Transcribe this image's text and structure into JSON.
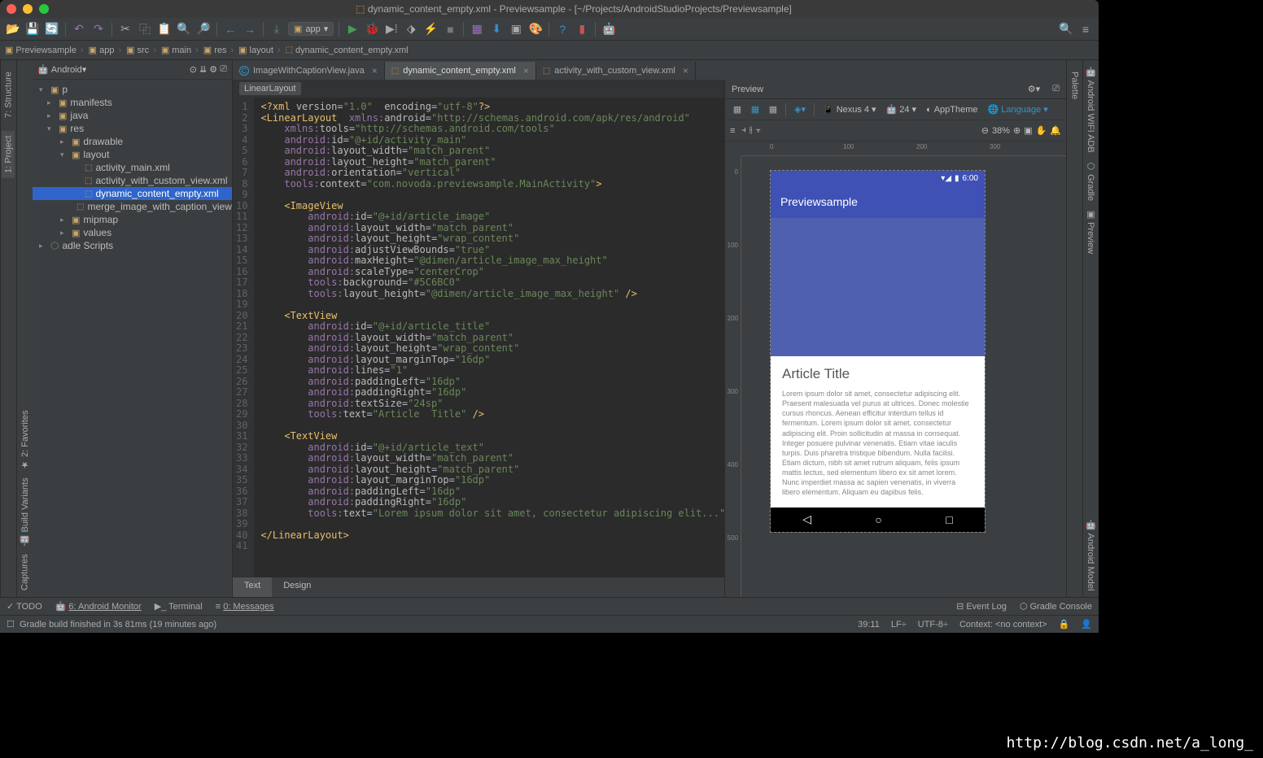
{
  "window_title": "dynamic_content_empty.xml - Previewsample - [~/Projects/AndroidStudioProjects/Previewsample]",
  "run_config": "app",
  "breadcrumb": [
    "Previewsample",
    "app",
    "src",
    "main",
    "res",
    "layout",
    "dynamic_content_empty.xml"
  ],
  "left_tabs": {
    "project": "1: Project",
    "structure": "7: Structure",
    "captures": "Captures",
    "bv": "Build Variants",
    "fav": "2: Favorites"
  },
  "project_header": "Android",
  "project_tree": {
    "root": "p",
    "items": [
      {
        "label": "manifests",
        "depth": 1,
        "icon": "folder",
        "tgl": "▸"
      },
      {
        "label": "java",
        "depth": 1,
        "icon": "folder",
        "tgl": "▸"
      },
      {
        "label": "res",
        "depth": 1,
        "icon": "folder",
        "tgl": "▾"
      },
      {
        "label": "drawable",
        "depth": 2,
        "icon": "folder",
        "tgl": "▸"
      },
      {
        "label": "layout",
        "depth": 2,
        "icon": "folder",
        "tgl": "▾"
      },
      {
        "label": "activity_main.xml",
        "depth": 3,
        "icon": "xml"
      },
      {
        "label": "activity_with_custom_view.xml",
        "depth": 3,
        "icon": "xml"
      },
      {
        "label": "dynamic_content_empty.xml",
        "depth": 3,
        "icon": "xml",
        "selected": true
      },
      {
        "label": "merge_image_with_caption_view.xml",
        "depth": 3,
        "icon": "xml"
      },
      {
        "label": "mipmap",
        "depth": 2,
        "icon": "folder",
        "tgl": "▸"
      },
      {
        "label": "values",
        "depth": 2,
        "icon": "folder",
        "tgl": "▸"
      }
    ],
    "scripts": "adle Scripts"
  },
  "editor_tabs": [
    {
      "label": "ImageWithCaptionView.java",
      "icon": "C"
    },
    {
      "label": "dynamic_content_empty.xml",
      "icon": "xml",
      "active": true
    },
    {
      "label": "activity_with_custom_view.xml",
      "icon": "xml"
    }
  ],
  "editor_crumb": "LinearLayout",
  "code_lines": 41,
  "bottom_tabs": {
    "text": "Text",
    "design": "Design"
  },
  "preview": {
    "title": "Preview",
    "device": "Nexus 4",
    "api": "24",
    "theme": "AppTheme",
    "lang": "Language",
    "zoom": "38%",
    "status_time": "6:00",
    "app_title": "Previewsample",
    "article_title": "Article Title",
    "article_text": "Lorem ipsum dolor sit amet, consectetur adipiscing elit. Praesent malesuada vel purus at ultrices. Donec molestie cursus rhoncus. Aenean efficitur interdum tellus id fermentum. Lorem ipsum dolor sit amet, consectetur adipiscing elit. Proin sollicitudin at massa in consequat. Integer posuere pulvinar venenatis. Etiam vitae iaculis turpis. Duis pharetra tristique bibendum. Nulla facilisi. Etiam dictum, nibh sit amet rutrum aliquam, felis ipsum mattis lectus, sed elementum libero ex sit amet lorem. Nunc imperdiet massa ac sapien venenatis, in viverra libero elementum. Aliquam eu dapibus felis."
  },
  "right_tabs": {
    "palette": "Palette",
    "adb": "Android WIFI ADB",
    "gradle": "Gradle",
    "preview": "Preview",
    "model": "Android Model"
  },
  "tool_windows": {
    "todo": "TODO",
    "monitor": "6: Android Monitor",
    "terminal": "Terminal",
    "messages": "0: Messages",
    "eventlog": "Event Log",
    "gradlec": "Gradle Console"
  },
  "status": {
    "msg": "Gradle build finished in 3s 81ms (19 minutes ago)",
    "pos": "39:11",
    "sep": "LF",
    "enc": "UTF-8",
    "ctx": "Context: <no context>"
  },
  "watermark": "http://blog.csdn.net/a_long_"
}
